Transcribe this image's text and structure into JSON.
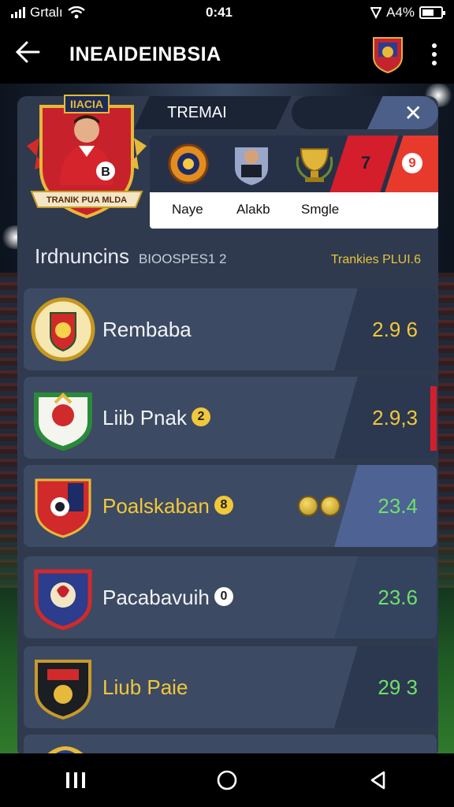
{
  "status": {
    "carrier": "Grtalı",
    "time": "0:41",
    "battery": "A4%"
  },
  "app_bar": {
    "title": "INEAIDEINBSIA"
  },
  "card": {
    "tab_label": "TREMAI",
    "player_badge_top": "IIACIA",
    "player_number": "B",
    "player_ribbon": "TRANIK PUA MLDA",
    "selector": [
      {
        "label": "Naye",
        "icon": "orange-crest-icon"
      },
      {
        "label": "Alakb",
        "icon": "player-avatar-icon"
      },
      {
        "label": "Smgle",
        "icon": "trophy-icon"
      }
    ],
    "red_number": "7",
    "red_symbol": "9"
  },
  "section": {
    "title": "Irdnuncins",
    "subtitle": "BIOOSPES1 2",
    "link": "Trankies PLUI.6"
  },
  "teams": [
    {
      "name": "Rembaba",
      "badge": "",
      "score": "2.9 6",
      "name_color": "white",
      "score_color": "yellow",
      "crest": "gold-red-crest-icon"
    },
    {
      "name": "Liib Pnak",
      "badge": "2",
      "score": "2.9,3",
      "name_color": "white",
      "name_accent": "Pnak",
      "score_color": "yellow",
      "crest": "green-crest-icon"
    },
    {
      "name": "Poalskaban",
      "badge": "8",
      "score": "23.4",
      "name_color": "yellow",
      "score_color": "green",
      "crest": "red-shield-crest-icon"
    },
    {
      "name": "Pacabavuih",
      "badge": "0",
      "score": "23.6",
      "name_color": "white",
      "score_color": "green",
      "crest": "blue-red-crest-icon"
    },
    {
      "name": "Liub Paie",
      "badge": "",
      "score": "29 3",
      "name_color": "yellow",
      "score_color": "green",
      "crest": "black-gold-crest-icon"
    }
  ],
  "colors": {
    "accent_yellow": "#f1c83a",
    "accent_green": "#6ee06a",
    "accent_red": "#d41e2b",
    "panel": "#2f3a4e"
  }
}
